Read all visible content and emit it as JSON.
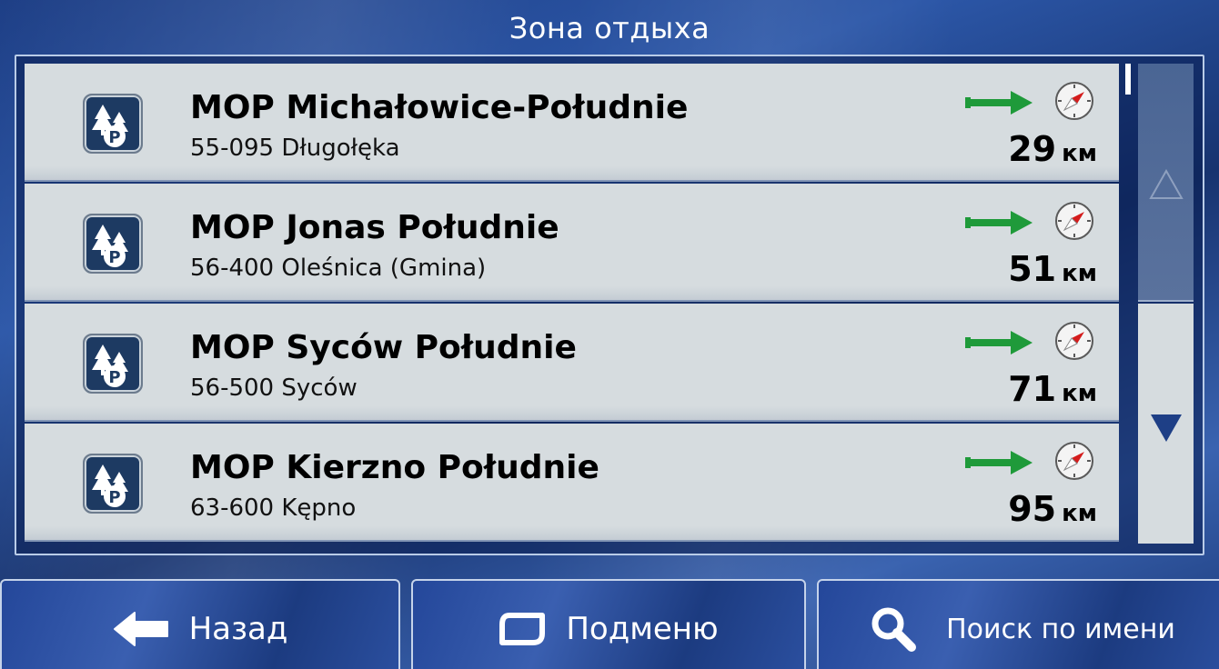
{
  "title": "Зона отдыха",
  "colors": {
    "row_bg": "#d6dcdf",
    "poi_icon_bg": "#1d3a62",
    "arrow_green": "#1f9a3a",
    "compass_needle": "#d41c1c",
    "scroll_arrow": "#1e3f86"
  },
  "results": [
    {
      "name": "MOP Michałowice-Południe",
      "address": "55-095 Długołęka",
      "distance": "29",
      "unit": "км",
      "poi_icon": "rest-area-parking-icon",
      "direction_icon": "arrow-right-icon",
      "compass_icon": "compass-icon"
    },
    {
      "name": "MOP Jonas Południe",
      "address": "56-400 Oleśnica (Gmina)",
      "distance": "51",
      "unit": "км",
      "poi_icon": "rest-area-parking-icon",
      "direction_icon": "arrow-right-icon",
      "compass_icon": "compass-icon"
    },
    {
      "name": "MOP Syców Południe",
      "address": "56-500 Syców",
      "distance": "71",
      "unit": "км",
      "poi_icon": "rest-area-parking-icon",
      "direction_icon": "arrow-right-icon",
      "compass_icon": "compass-icon"
    },
    {
      "name": "MOP Kierzno Południe",
      "address": "63-600 Kępno",
      "distance": "95",
      "unit": "км",
      "poi_icon": "rest-area-parking-icon",
      "direction_icon": "arrow-right-icon",
      "compass_icon": "compass-icon"
    }
  ],
  "scrollbar": {
    "up_icon": "triangle-up-icon",
    "down_icon": "triangle-down-icon"
  },
  "buttons": {
    "back": {
      "label": "Назад",
      "icon": "arrow-left-icon"
    },
    "submenu": {
      "label": "Подменю",
      "icon": "submenu-icon"
    },
    "search": {
      "label": "Поиск по имени",
      "icon": "search-icon"
    }
  }
}
